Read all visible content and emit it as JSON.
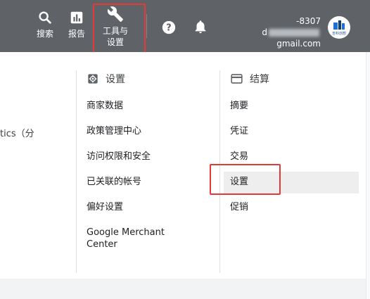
{
  "topbar": {
    "search_label": "搜索",
    "report_label": "报告",
    "tools_label_line1": "工具与",
    "tools_label_line2": "设置",
    "help_icon": "help-circle-icon",
    "notifications_icon": "bell-icon",
    "account_phone": "-8307",
    "account_email_prefix": "d",
    "account_email_suffix": "gmail.com",
    "avatar_text": "吉科创想"
  },
  "left_column": {
    "partial_text": "tics（分"
  },
  "settings_column": {
    "header": "设置",
    "items": [
      "商家数据",
      "政策管理中心",
      "访问权限和安全",
      "已关联的帐号",
      "偏好设置",
      "Google Merchant Center"
    ]
  },
  "billing_column": {
    "header": "结算",
    "items": [
      "摘要",
      "凭证",
      "交易",
      "设置",
      "促销"
    ],
    "selected": "设置"
  },
  "colors": {
    "topbar": "#5f6368",
    "highlight": "#e53935",
    "selected_row": "#eeeeee"
  }
}
